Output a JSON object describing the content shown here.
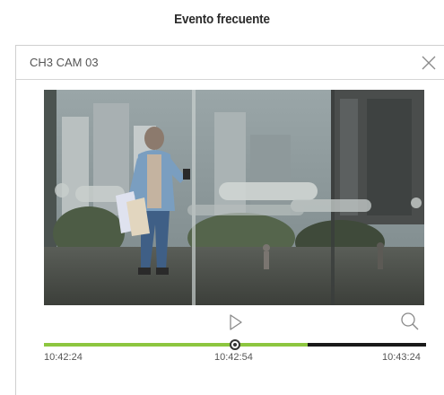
{
  "page": {
    "heading": "Evento frecuente"
  },
  "dialog": {
    "title": "CH3 CAM 03",
    "close_icon": "close-icon"
  },
  "player": {
    "play_icon": "play-icon",
    "zoom_icon": "magnifier-icon",
    "colors": {
      "played": "#8dc63f",
      "remaining": "#1a1a1a"
    },
    "position_fraction": 0.5,
    "buffered_fraction": 0.69,
    "times": {
      "start": "10:42:24",
      "current": "10:42:54",
      "end": "10:43:24"
    }
  }
}
